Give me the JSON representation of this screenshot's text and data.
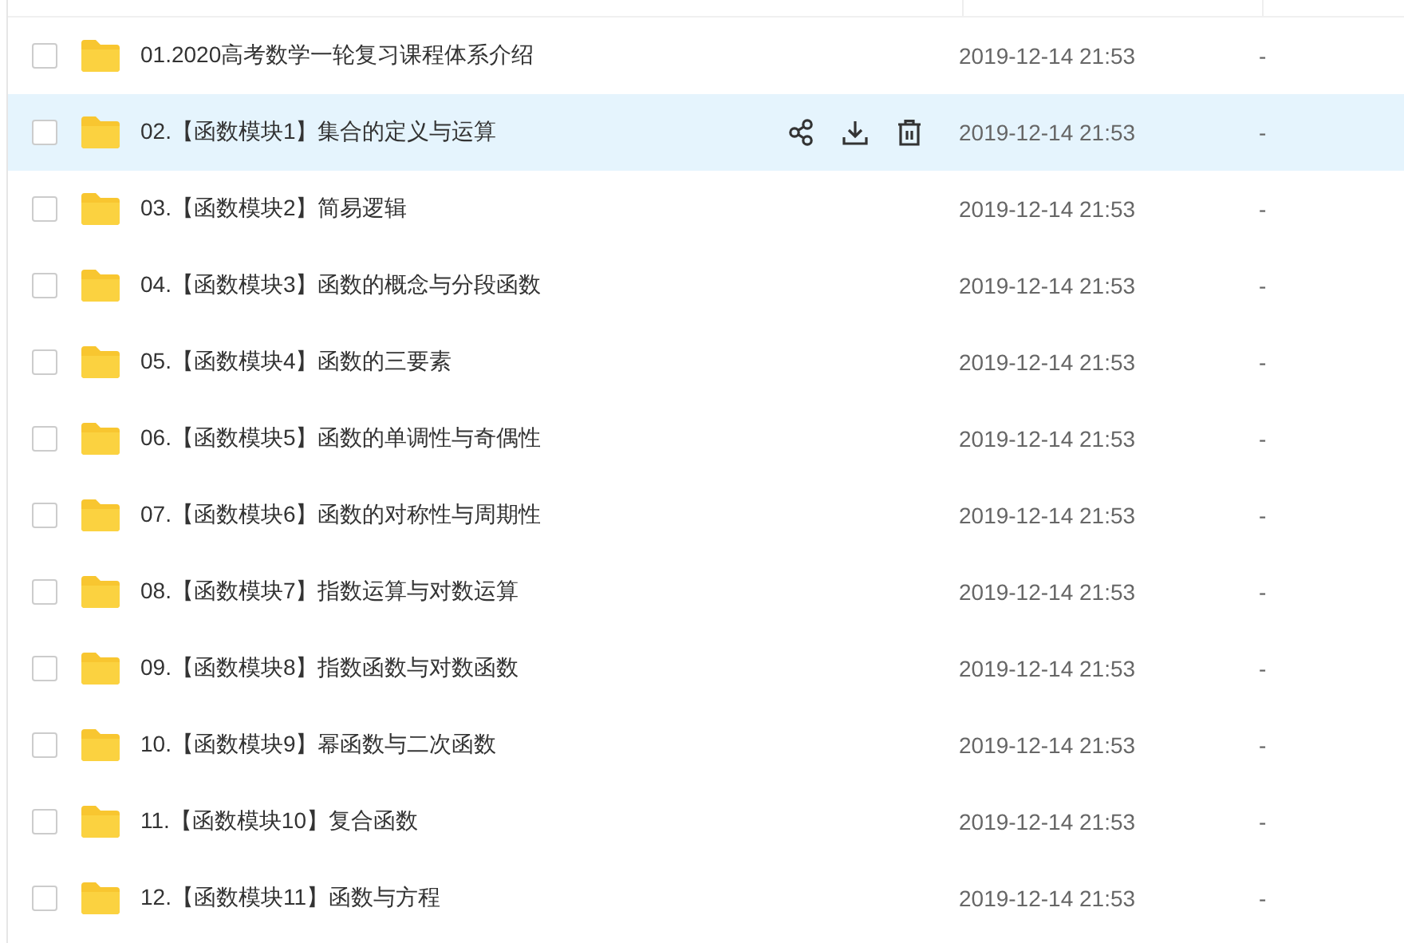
{
  "files": [
    {
      "name": "01.2020高考数学一轮复习课程体系介绍",
      "modified": "2019-12-14 21:53",
      "size": "-",
      "checked": false,
      "highlighted": false
    },
    {
      "name": "02.【函数模块1】集合的定义与运算",
      "modified": "2019-12-14 21:53",
      "size": "-",
      "checked": false,
      "highlighted": true
    },
    {
      "name": "03.【函数模块2】简易逻辑",
      "modified": "2019-12-14 21:53",
      "size": "-",
      "checked": false,
      "highlighted": false
    },
    {
      "name": "04.【函数模块3】函数的概念与分段函数",
      "modified": "2019-12-14 21:53",
      "size": "-",
      "checked": false,
      "highlighted": false
    },
    {
      "name": "05.【函数模块4】函数的三要素",
      "modified": "2019-12-14 21:53",
      "size": "-",
      "checked": false,
      "highlighted": false
    },
    {
      "name": "06.【函数模块5】函数的单调性与奇偶性",
      "modified": "2019-12-14 21:53",
      "size": "-",
      "checked": false,
      "highlighted": false
    },
    {
      "name": "07.【函数模块6】函数的对称性与周期性",
      "modified": "2019-12-14 21:53",
      "size": "-",
      "checked": false,
      "highlighted": false
    },
    {
      "name": "08.【函数模块7】指数运算与对数运算",
      "modified": "2019-12-14 21:53",
      "size": "-",
      "checked": false,
      "highlighted": false
    },
    {
      "name": "09.【函数模块8】指数函数与对数函数",
      "modified": "2019-12-14 21:53",
      "size": "-",
      "checked": false,
      "highlighted": false
    },
    {
      "name": "10.【函数模块9】幂函数与二次函数",
      "modified": "2019-12-14 21:53",
      "size": "-",
      "checked": false,
      "highlighted": false
    },
    {
      "name": "11.【函数模块10】复合函数",
      "modified": "2019-12-14 21:53",
      "size": "-",
      "checked": false,
      "highlighted": false
    },
    {
      "name": "12.【函数模块11】函数与方程",
      "modified": "2019-12-14 21:53",
      "size": "-",
      "checked": false,
      "highlighted": false
    }
  ]
}
